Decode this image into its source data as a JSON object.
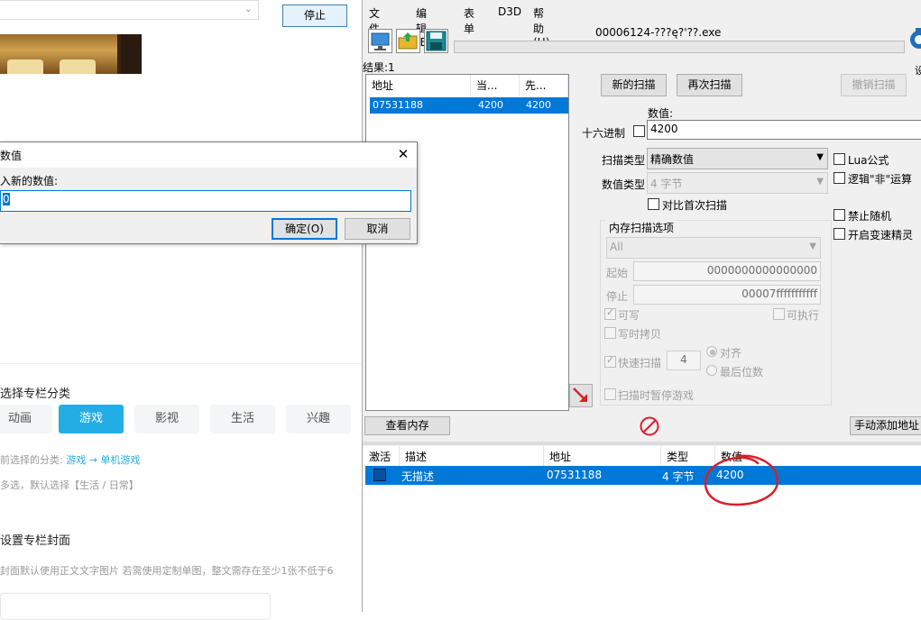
{
  "left_page": {
    "stop_button": "停止",
    "section_title": "选择专栏分类",
    "categories": [
      "动画",
      "游戏",
      "影视",
      "生活",
      "兴趣"
    ],
    "selected_category_prefix": "前选择的分类:",
    "selected_category_value": "游戏 → 单机游戏",
    "multi_select_hint": "多选，默认选择【生活 / 日常】",
    "cover_title": "设置专栏封面",
    "cover_hint": "封面默认使用正文文字图片 若需使用定制单图，整文需存在至少1张不低于6"
  },
  "dialog": {
    "title": "数值",
    "prompt": "入新的数值:",
    "input_value": "0",
    "ok_label": "确定(O)",
    "cancel_label": "取消",
    "close_glyph": "✕"
  },
  "ce": {
    "menu": [
      "文件(F)",
      "编辑(E)",
      "表单",
      "D3D",
      "帮助(H)"
    ],
    "process_title": "00006124-???ę?'??.exe",
    "results_label": "结果:1",
    "results_columns": [
      "地址",
      "当...",
      "先..."
    ],
    "result_row": {
      "address": "07531188",
      "current": "4200",
      "previous": "4200"
    },
    "buttons": {
      "new_scan": "新的扫描",
      "next_scan": "再次扫描",
      "undo_scan": "撤销扫描",
      "view_memory": "查看内存",
      "add_address": "手动添加地址"
    },
    "value_label": "数值:",
    "hex_label": "十六进制",
    "value_input": "4200",
    "scan_type_label": "扫描类型",
    "scan_type_value": "精确数值",
    "value_type_label": "数值类型",
    "value_type_value": "4 字节",
    "compare_first": "对比首次扫描",
    "lua_formula": "Lua公式",
    "logic_not": "逻辑\"非\"运算",
    "no_random": "禁止随机",
    "speedhack": "开启变速精灵",
    "mem_options_title": "内存扫描选项",
    "mem_region": "All",
    "start_label": "起始",
    "start_value": "0000000000000000",
    "stop_label": "停止",
    "stop_value": "00007fffffffffff",
    "writable": "可写",
    "executable": "可执行",
    "copy_on_write": "写时拷贝",
    "fast_scan": "快速扫描",
    "fast_scan_value": "4",
    "align": "对齐",
    "last_digits": "最后位数",
    "pause_game": "扫描时暂停游戏",
    "table_columns": [
      "激活",
      "描述",
      "地址",
      "类型",
      "数值"
    ],
    "table_row": {
      "description": "无描述",
      "address": "07531188",
      "type": "4 字节",
      "value": "4200"
    },
    "logo_char": "设"
  },
  "colors": {
    "accent": "#23ade5",
    "selection": "#0078d7",
    "annotation": "#d8202a"
  }
}
